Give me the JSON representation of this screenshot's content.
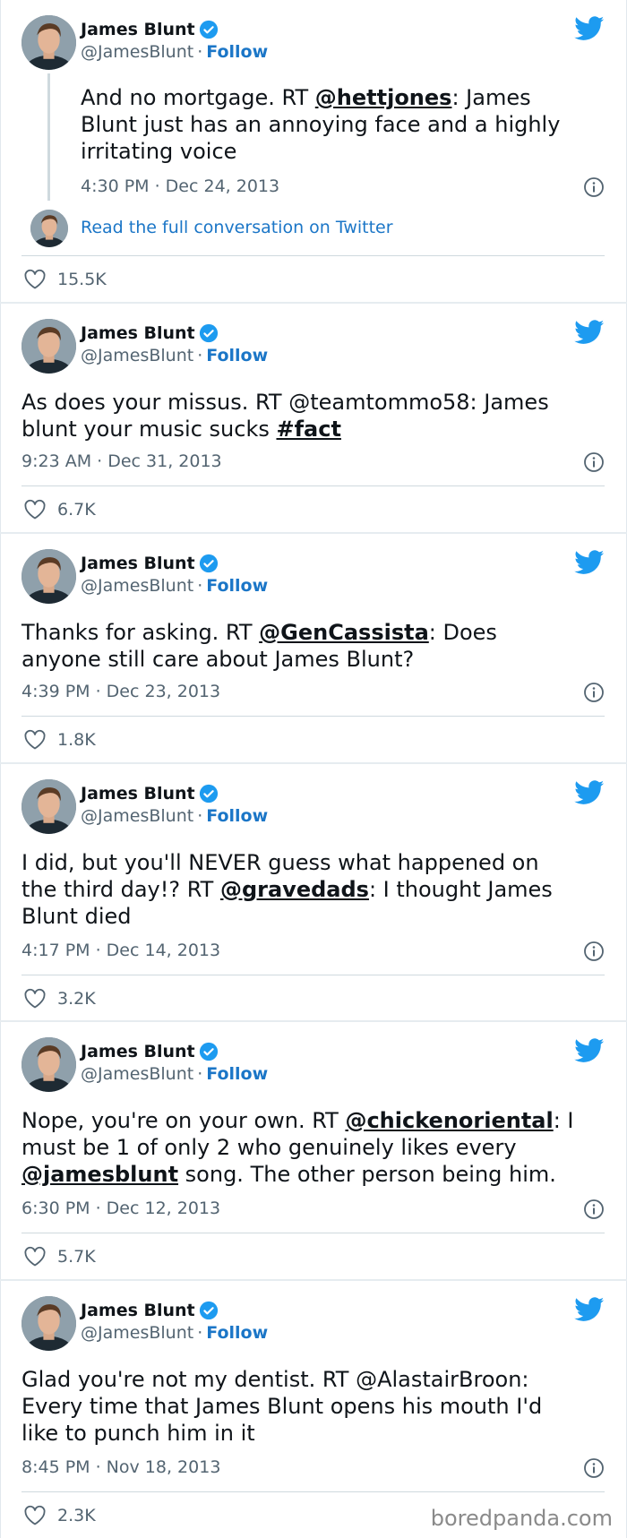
{
  "author": {
    "name": "James Blunt",
    "handle": "@JamesBlunt",
    "separator": "·",
    "follow_label": "Follow"
  },
  "colors": {
    "twitter_blue": "#1d9bf0",
    "link_blue": "#1b76c7",
    "text": "#0f1419",
    "muted": "#536471"
  },
  "icons": {
    "verified": "verified-badge-icon",
    "bird": "twitter-bird-icon",
    "info": "info-icon",
    "like": "heart-icon"
  },
  "thread_link": "Read the full conversation on Twitter",
  "tweets": [
    {
      "lines": [
        [
          "And no mortgage. RT ",
          "@hettjones",
          ": James"
        ],
        [
          "Blunt just has an annoying face and a highly"
        ],
        [
          "irritating voice"
        ]
      ],
      "time": "4:30 PM · Dec 24, 2013",
      "likes": "15.5K"
    },
    {
      "lines": [
        [
          "As does your missus. RT @teamtommo58: James"
        ],
        [
          "blunt your music sucks ",
          "#fact"
        ]
      ],
      "time": "9:23 AM · Dec 31, 2013",
      "likes": "6.7K"
    },
    {
      "lines": [
        [
          "Thanks for asking. RT ",
          "@GenCassista",
          ": Does"
        ],
        [
          "anyone still care about James Blunt?"
        ]
      ],
      "time": "4:39 PM · Dec 23, 2013",
      "likes": "1.8K"
    },
    {
      "lines": [
        [
          "I did, but you'll NEVER guess what happened on"
        ],
        [
          "the third day!? RT ",
          "@gravedads",
          ": I thought James"
        ],
        [
          "Blunt died"
        ]
      ],
      "time": "4:17 PM · Dec 14, 2013",
      "likes": "3.2K"
    },
    {
      "lines": [
        [
          "Nope, you're on your own. RT ",
          "@chickenoriental",
          ": I"
        ],
        [
          "must be 1 of only 2 who genuinely likes every"
        ],
        [
          "",
          "@jamesblunt",
          " song. The other person being him."
        ]
      ],
      "time": "6:30 PM · Dec 12, 2013",
      "likes": "5.7K"
    },
    {
      "lines": [
        [
          "Glad you're not my dentist. RT @AlastairBroon:"
        ],
        [
          "Every time that James Blunt opens his mouth I'd"
        ],
        [
          "like to punch him in it"
        ]
      ],
      "time": "8:45 PM · Nov 18, 2013",
      "likes": "2.3K"
    }
  ],
  "watermark": "boredpanda.com"
}
